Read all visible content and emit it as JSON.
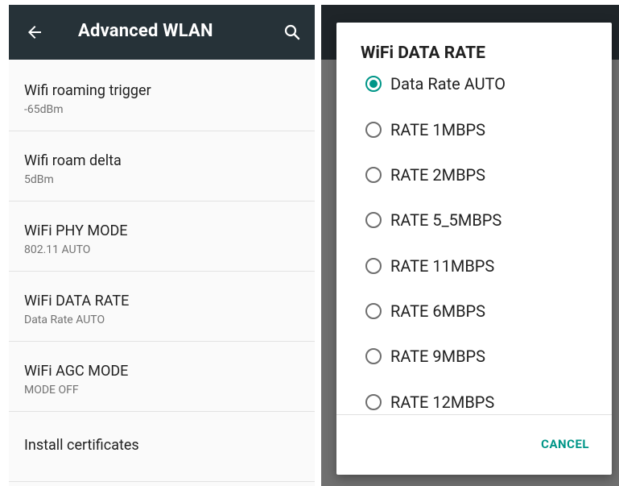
{
  "left": {
    "appbar": {
      "title": "Advanced WLAN",
      "back_icon": "arrow-back-icon",
      "search_icon": "search-icon",
      "bg_color": "#263238"
    },
    "settings": [
      {
        "title": "Wifi roaming trigger",
        "summary": "-65dBm"
      },
      {
        "title": "Wifi roam delta",
        "summary": "5dBm"
      },
      {
        "title": "WiFi PHY MODE",
        "summary": "802.11 AUTO"
      },
      {
        "title": "WiFi DATA RATE",
        "summary": "Data Rate AUTO"
      },
      {
        "title": "WiFi AGC MODE",
        "summary": "MODE OFF"
      },
      {
        "title": "Install certificates",
        "summary": ""
      }
    ]
  },
  "dialog": {
    "title": "WiFi DATA RATE",
    "selected": "Data Rate AUTO",
    "accent_color": "#009688",
    "options": [
      "Data Rate AUTO",
      "RATE 1MBPS",
      "RATE 2MBPS",
      "RATE 5_5MBPS",
      "RATE 11MBPS",
      "RATE 6MBPS",
      "RATE 9MBPS",
      "RATE 12MBPS"
    ],
    "cancel_label": "CANCEL"
  }
}
